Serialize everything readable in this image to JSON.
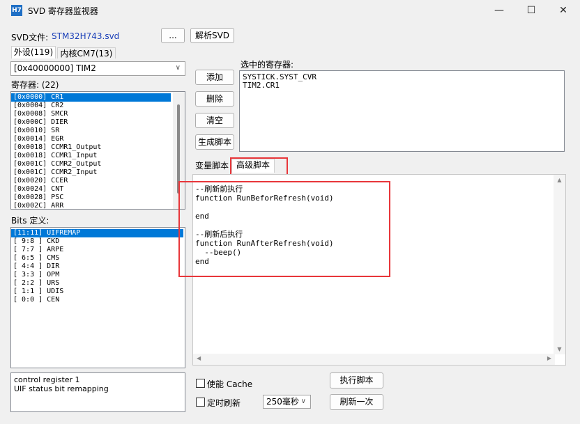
{
  "window": {
    "icon_text": "H7",
    "title": "SVD 寄存器监视器",
    "minimize": "—",
    "maximize": "☐",
    "close": "✕"
  },
  "svd": {
    "label": "SVD文件:",
    "file": "STM32H743.svd",
    "browse_button": "...",
    "parse_button": "解析SVD"
  },
  "left_tabs": [
    {
      "label": "外设(119)",
      "active": true
    },
    {
      "label": "内核CM7(13)",
      "active": false
    }
  ],
  "peripheral_select": "[0x40000000] TIM2",
  "registers": {
    "label": "寄存器: (22)",
    "items": [
      "[0x0000] CR1",
      "[0x0004] CR2",
      "[0x0008] SMCR",
      "[0x000C] DIER",
      "[0x0010] SR",
      "[0x0014] EGR",
      "[0x0018] CCMR1_Output",
      "[0x0018] CCMR1_Input",
      "[0x001C] CCMR2_Output",
      "[0x001C] CCMR2_Input",
      "[0x0020] CCER",
      "[0x0024] CNT",
      "[0x0028] PSC",
      "[0x002C] ARR"
    ],
    "selected_index": 0
  },
  "bits": {
    "label": "Bits 定义:",
    "items": [
      "[11:11] UIFREMAP",
      "[ 9:8 ] CKD",
      "[ 7:7 ] ARPE",
      "[ 6:5 ] CMS",
      "[ 4:4 ] DIR",
      "[ 3:3 ] OPM",
      "[ 2:2 ] URS",
      "[ 1:1 ] UDIS",
      "[ 0:0 ] CEN"
    ],
    "selected_index": 0
  },
  "description": {
    "line1": "control register 1",
    "line2": "UIF status bit remapping"
  },
  "actions": {
    "add": "添加",
    "delete": "删除",
    "clear": "清空",
    "generate": "生成脚本"
  },
  "selected_registers": {
    "label": "选中的寄存器:",
    "items": [
      "SYSTICK.SYST_CVR",
      "TIM2.CR1"
    ]
  },
  "script_tabs": [
    {
      "label": "变量脚本",
      "active": false
    },
    {
      "label": "高级脚本",
      "active": true
    }
  ],
  "script_lines": [
    "--刷新前执行",
    "function RunBeforRefresh(void)",
    "",
    "end",
    "",
    "--刷新后执行",
    "function RunAfterRefresh(void)",
    "  --beep()",
    "end"
  ],
  "bottom": {
    "cache_label": "使能 Cache",
    "timer_label": "定时刷新",
    "interval": "250毫秒",
    "run_button": "执行脚本",
    "refresh_button": "刷新一次"
  },
  "colors": {
    "accent": "#0078d7",
    "highlight_border": "#e8363a",
    "link": "#1a3fb8"
  }
}
